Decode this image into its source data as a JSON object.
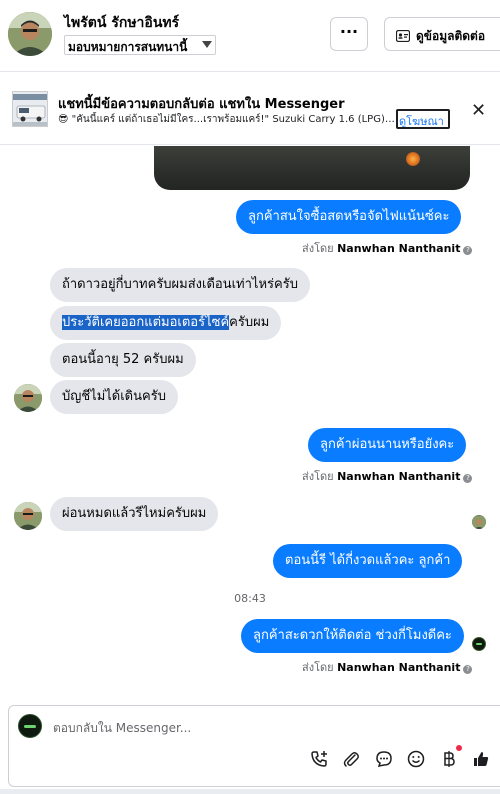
{
  "header": {
    "contact_name": "ไพรัตน์ รักษาอินทร์",
    "assign_label": "มอบหมายการสนทนานี้",
    "more_label": "···",
    "contact_info_label": "ดูข้อมูลติดต่อ"
  },
  "banner": {
    "title": "แชทนี้มีข้อความตอบกลับต่อ แชทใน Messenger",
    "subtitle": "😎 \"คันนี้แคร์ แต่ถ้าเธอไม่มีใคร...เราพร้อมแคร์!\" Suzuki Carry 1.6 (LPG) M...",
    "link_label": "ดูโฆษณา",
    "close_label": "✕"
  },
  "messages": [
    {
      "id": "m1",
      "side": "out",
      "text": "ลูกค้าสนใจซื้อสดหรือจัดไฟแน้นซ์คะ"
    },
    {
      "id": "m2",
      "side": "in",
      "text": "ถ้าดาวอยู่กี่บาทครับผมส่งเดือนเท่าไหร่ครับ"
    },
    {
      "id": "m3",
      "side": "in",
      "text_selected": "ประวัติเคยออกแต่มอเตอร์ไซค์",
      "text_rest": "ครับผม"
    },
    {
      "id": "m4",
      "side": "in",
      "text": "ตอนนี้อายุ 52 ครับผม"
    },
    {
      "id": "m5",
      "side": "in",
      "text": "บัญชีไม่ได้เดินครับ"
    },
    {
      "id": "m6",
      "side": "out",
      "text": "ลูกค้าผ่อนนานหรือยังคะ"
    },
    {
      "id": "m7",
      "side": "in",
      "text": "ผ่อนหมดแล้วรีไหม่ครับผม"
    },
    {
      "id": "m8",
      "side": "out",
      "text": "ตอนนี้รี ได้กี่งวดแล้วคะ  ลูกค้า"
    },
    {
      "id": "m9",
      "side": "out",
      "text": "ลูกค้าสะดวกให้ติดต่อ ช่วงกี่โมงดีคะ"
    }
  ],
  "sent_by": {
    "prefix": "ส่งโดย",
    "name": "Nanwhan Nanthanit",
    "info": "?"
  },
  "timestamp": "08:43",
  "composer": {
    "placeholder": "ตอบกลับใน Messenger..."
  },
  "icons": {
    "call": "phone-plus-icon",
    "attach": "paperclip-icon",
    "chat": "chat-bubble-icon",
    "emoji": "smiley-icon",
    "currency": "baht-icon",
    "like": "thumbs-up-icon"
  },
  "colors": {
    "outgoing_bubble": "#0a7cff",
    "incoming_bubble": "#e4e6eb",
    "selection": "#1a64c8",
    "link": "#1877f2",
    "notification_dot": "#f02849"
  }
}
